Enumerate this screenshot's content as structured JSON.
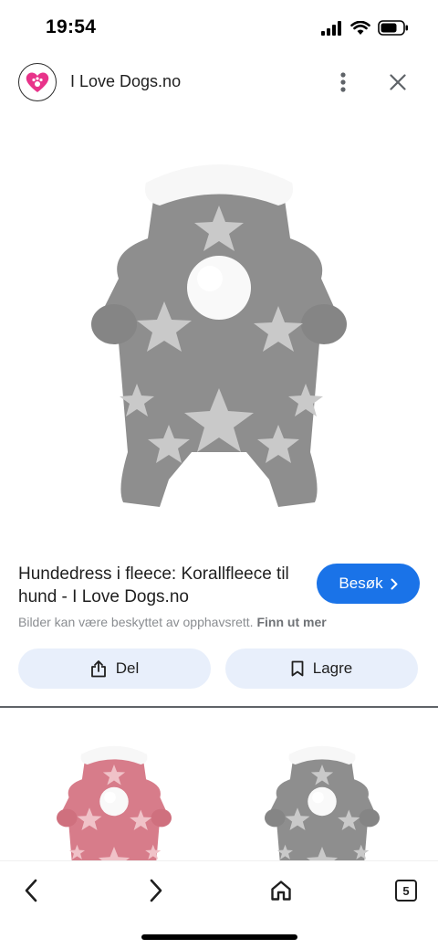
{
  "status_bar": {
    "time": "19:54",
    "icons": [
      "cellular-signal-icon",
      "wifi-icon",
      "battery-icon"
    ]
  },
  "header": {
    "site_name": "I Love Dogs.no",
    "logo_icon": "heart-paw-logo",
    "menu_icon": "more-vertical-icon",
    "close_icon": "close-icon"
  },
  "main_image": {
    "subject": "grey-star-fleece-dog-jumpsuit"
  },
  "info": {
    "title": "Hundedress i fleece: Korallfleece til hund - I Love Dogs.no",
    "visit_label": "Besøk",
    "copyright_text": "Bilder kan være beskyttet av opphavsrett.",
    "learn_more_label": "Finn ut mer",
    "share_label": "Del",
    "save_label": "Lagre"
  },
  "related": [
    {
      "subject": "pink-star-fleece-dog-jumpsuit"
    },
    {
      "subject": "grey-star-fleece-dog-jumpsuit"
    }
  ],
  "bottom_nav": {
    "tab_count": "5",
    "icons": [
      "back-icon",
      "forward-icon",
      "home-icon",
      "tabs-icon"
    ]
  },
  "colors": {
    "accent": "#1a73e8",
    "button_bg": "#e8effb",
    "logo_pink": "#e8338a",
    "fleece_grey": "#8e8e8e",
    "fleece_pink": "#d77c8a"
  }
}
